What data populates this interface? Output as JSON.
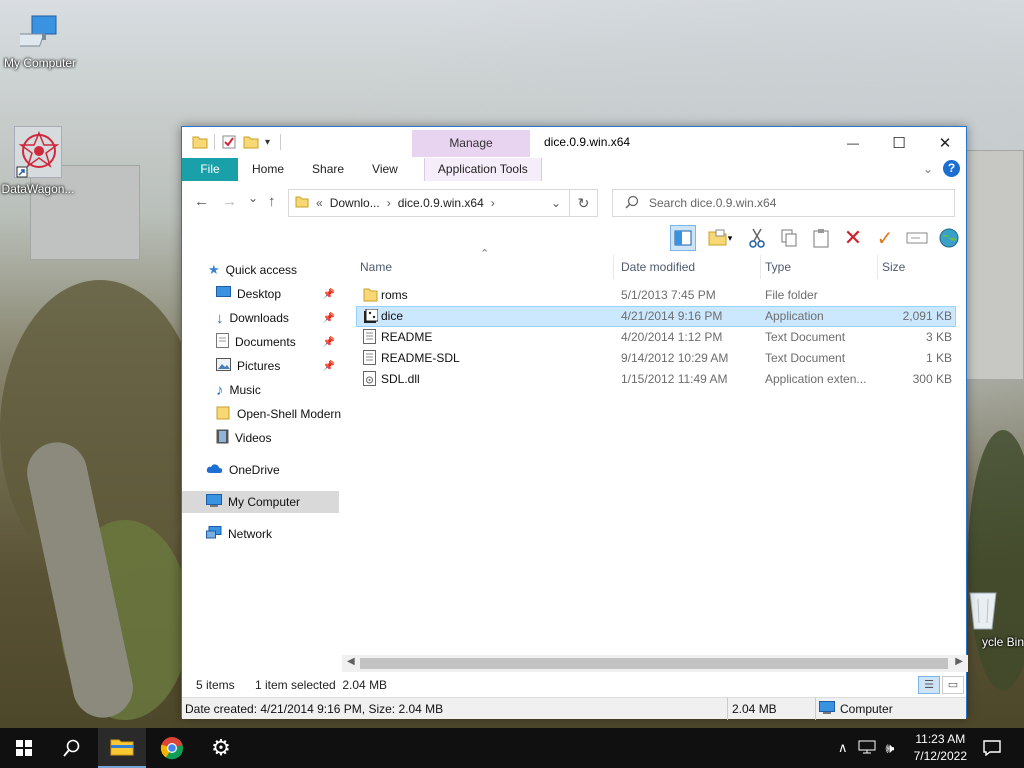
{
  "desktop": {
    "icons": [
      {
        "label": "My Computer"
      },
      {
        "label": "DataWagon..."
      },
      {
        "label": "ycle Bin"
      }
    ]
  },
  "window": {
    "title": "dice.0.9.win.x64",
    "contextual_tab": "Manage",
    "tabs": [
      "File",
      "Home",
      "Share",
      "View",
      "Application Tools"
    ],
    "help_label": "?",
    "minimize": "—",
    "maximize": "☐",
    "close": "✕"
  },
  "address": {
    "overflow": "«",
    "crumbs": [
      "Downlo...",
      "dice.0.9.win.x64"
    ],
    "separator": "›",
    "dropdown": "⌄",
    "refresh": "↻",
    "search_placeholder": "Search dice.0.9.win.x64"
  },
  "nav_buttons": {
    "back": "←",
    "forward": "→",
    "recent": "⌄",
    "up": "↑"
  },
  "navpane": {
    "items": [
      {
        "label": "Quick access",
        "icon": "star-icon",
        "pinned": false
      },
      {
        "label": "Desktop",
        "icon": "desktop-icon",
        "pinned": true
      },
      {
        "label": "Downloads",
        "icon": "download-arrow-icon",
        "pinned": true
      },
      {
        "label": "Documents",
        "icon": "documents-icon",
        "pinned": true
      },
      {
        "label": "Pictures",
        "icon": "pictures-icon",
        "pinned": true
      },
      {
        "label": "Music",
        "icon": "music-note-icon",
        "pinned": false
      },
      {
        "label": "Open-Shell Modern",
        "icon": "folder-icon",
        "pinned": false
      },
      {
        "label": "Videos",
        "icon": "film-icon",
        "pinned": false
      },
      {
        "label": "OneDrive",
        "icon": "cloud-icon",
        "pinned": false
      },
      {
        "label": "My Computer",
        "icon": "computer-icon",
        "pinned": false
      },
      {
        "label": "Network",
        "icon": "network-icon",
        "pinned": false
      }
    ],
    "pin_glyph": "📌"
  },
  "filelist": {
    "columns": [
      "Name",
      "Date modified",
      "Type",
      "Size"
    ],
    "sort_glyph": "⌃",
    "rows": [
      {
        "name": "roms",
        "date": "5/1/2013 7:45 PM",
        "type": "File folder",
        "size": "",
        "icon": "folder-icon"
      },
      {
        "name": "dice",
        "date": "4/21/2014 9:16 PM",
        "type": "Application",
        "size": "2,091 KB",
        "icon": "application-icon"
      },
      {
        "name": "README",
        "date": "4/20/2014 1:12 PM",
        "type": "Text Document",
        "size": "3 KB",
        "icon": "text-file-icon"
      },
      {
        "name": "README-SDL",
        "date": "9/14/2012 10:29 AM",
        "type": "Text Document",
        "size": "1 KB",
        "icon": "text-file-icon"
      },
      {
        "name": "SDL.dll",
        "date": "1/15/2012 11:49 AM",
        "type": "Application exten...",
        "size": "300 KB",
        "icon": "dll-file-icon"
      }
    ]
  },
  "status": {
    "items_count": "5 items",
    "selection": "1 item selected  2.04 MB"
  },
  "details": {
    "text": "Date created: 4/21/2014 9:16 PM, Size: 2.04 MB",
    "size": "2.04 MB",
    "location": "Computer"
  },
  "taskbar": {
    "clock_time": "11:23 AM",
    "clock_date": "7/12/2022",
    "apps": [
      "start-icon",
      "search-icon",
      "file-explorer-icon",
      "chrome-icon",
      "settings-gear-icon"
    ]
  }
}
